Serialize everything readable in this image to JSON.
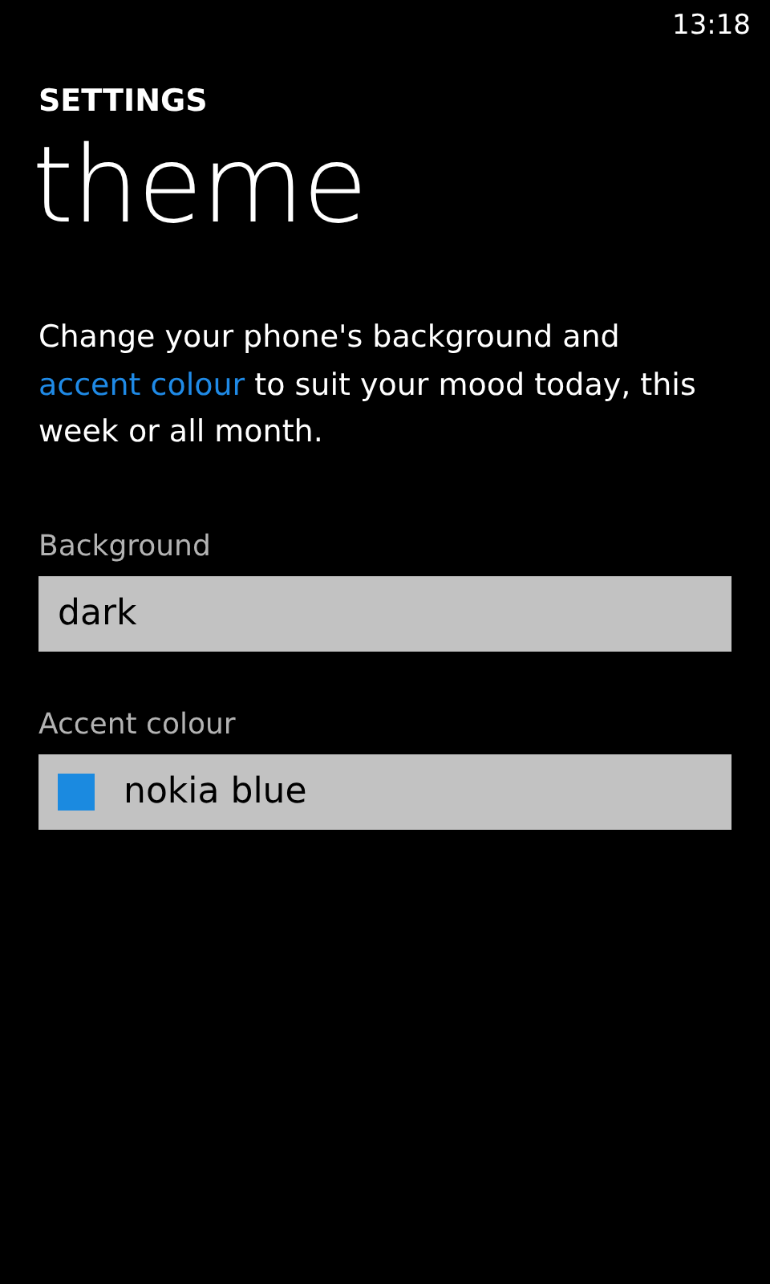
{
  "status_bar": {
    "time": "13:18"
  },
  "header": {
    "app": "SETTINGS",
    "title": "theme"
  },
  "description": {
    "before": "Change your phone's background and ",
    "link": "accent colour",
    "after": " to suit your mood today, this week or all month."
  },
  "pickers": [
    {
      "kind": "text",
      "label": "Background",
      "value": "dark"
    },
    {
      "kind": "swatch",
      "label": "Accent colour",
      "value": "nokia blue",
      "color": "#1b8ae0"
    }
  ]
}
